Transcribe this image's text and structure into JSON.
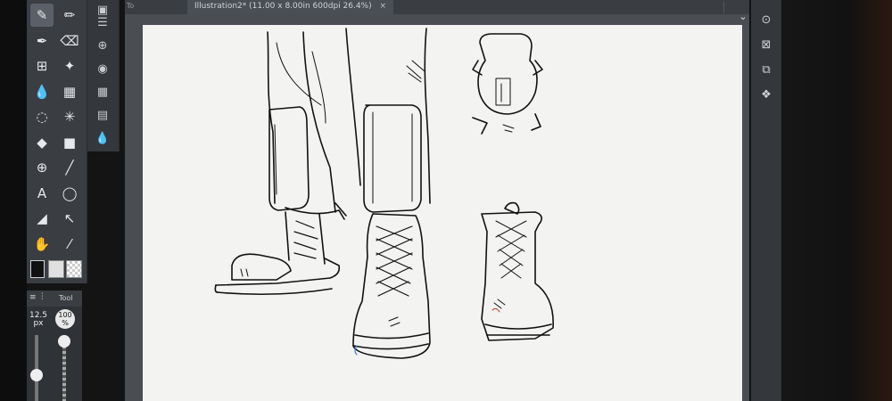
{
  "document_tab": {
    "title": "Illustration2* (11.00 x 8.00in 600dpi 26.4%)",
    "close_glyph": "×",
    "prev_tab_fragment": "To"
  },
  "tools": [
    {
      "name": "pen-tool-icon",
      "glyph": "✎",
      "selected": true
    },
    {
      "name": "pencil-tool-icon",
      "glyph": "✏",
      "selected": false
    },
    {
      "name": "brush-tool-icon",
      "glyph": "✒",
      "selected": false
    },
    {
      "name": "eraser-tool-icon",
      "glyph": "⌫",
      "selected": false
    },
    {
      "name": "fill-tool-icon",
      "glyph": "⊞",
      "selected": false
    },
    {
      "name": "sparkle-tool-icon",
      "glyph": "✦",
      "selected": false
    },
    {
      "name": "blend-tool-icon",
      "glyph": "💧",
      "selected": false
    },
    {
      "name": "grid-tool-icon",
      "glyph": "▦",
      "selected": false
    },
    {
      "name": "lasso-tool-icon",
      "glyph": "◌",
      "selected": false
    },
    {
      "name": "magic-wand-icon",
      "glyph": "✳",
      "selected": false
    },
    {
      "name": "bucket-tool-icon",
      "glyph": "◆",
      "selected": false
    },
    {
      "name": "gradient-tool-icon",
      "glyph": "■",
      "selected": false
    },
    {
      "name": "move-layer-icon",
      "glyph": "⊕",
      "selected": false
    },
    {
      "name": "line-tool-icon",
      "glyph": "╱",
      "selected": false
    },
    {
      "name": "text-tool-icon",
      "glyph": "A",
      "selected": false
    },
    {
      "name": "balloon-tool-icon",
      "glyph": "◯",
      "selected": false
    },
    {
      "name": "ruler-tool-icon",
      "glyph": "◢",
      "selected": false
    },
    {
      "name": "operation-tool-icon",
      "glyph": "↖",
      "selected": false
    },
    {
      "name": "hand-tool-icon",
      "glyph": "✋",
      "selected": false
    },
    {
      "name": "eyedropper-tool-icon",
      "glyph": "⁄",
      "selected": false
    }
  ],
  "colors": {
    "main": "#111111",
    "sub": "#e0e0e0",
    "accent_tab": "#4a4e55"
  },
  "brush": {
    "header_label": "Tool",
    "size_value": "12.5",
    "size_unit": "px",
    "opacity_value": "100",
    "opacity_unit": "%"
  },
  "icons": {
    "menu": "≡",
    "sliders": "⫶",
    "collapse": "⌄"
  }
}
